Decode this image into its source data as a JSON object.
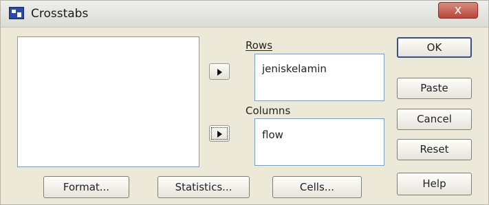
{
  "window": {
    "title": "Crosstabs",
    "close_glyph": "x"
  },
  "rows": {
    "label": "Rows",
    "items": [
      "jeniskelamin"
    ]
  },
  "columns": {
    "label": "Columns",
    "items": [
      "flow"
    ]
  },
  "buttons": {
    "ok": "OK",
    "paste": "Paste",
    "cancel": "Cancel",
    "reset": "Reset",
    "help": "Help",
    "format": "Format...",
    "statistics": "Statistics...",
    "cells": "Cells..."
  },
  "icons": {
    "app": "crosstabs-app-icon",
    "move": "right-arrow-icon",
    "close": "close-icon"
  }
}
